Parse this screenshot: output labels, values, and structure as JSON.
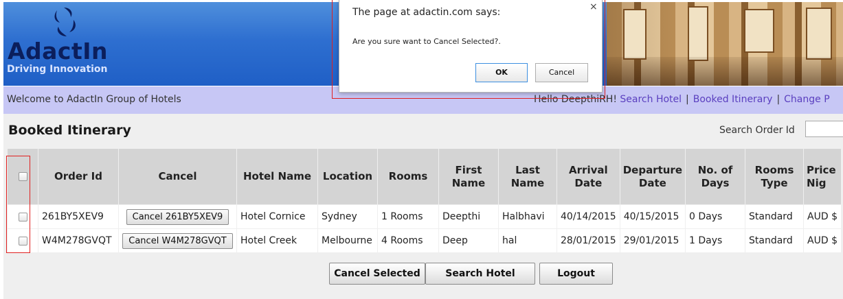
{
  "header": {
    "brand_name": "AdactIn",
    "tagline": "Driving Innovation"
  },
  "navbar": {
    "welcome": "Welcome to AdactIn Group of Hotels",
    "greeting": "Hello DeepthiRH!",
    "links": [
      "Search Hotel",
      "Booked Itinerary",
      "Change P"
    ]
  },
  "main": {
    "title": "Booked Itinerary",
    "search_label": "Search Order Id",
    "search_value": ""
  },
  "table": {
    "headers": [
      "Order Id",
      "Cancel",
      "Hotel Name",
      "Location",
      "Rooms",
      "First\nName",
      "Last\nName",
      "Arrival\nDate",
      "Departure\nDate",
      "No. of\nDays",
      "Rooms\nType",
      "Price\nNig"
    ],
    "rows": [
      {
        "order_id": "261BY5XEV9",
        "cancel_label": "Cancel 261BY5XEV9",
        "hotel_name": "Hotel Cornice",
        "location": "Sydney",
        "rooms": "1 Rooms",
        "first_name": "Deepthi",
        "last_name": "Halbhavi",
        "arrival": "40/14/2015",
        "departure": "40/15/2015",
        "days": "0 Days",
        "room_type": "Standard",
        "price": "AUD $"
      },
      {
        "order_id": "W4M278GVQT",
        "cancel_label": "Cancel W4M278GVQT",
        "hotel_name": "Hotel Creek",
        "location": "Melbourne",
        "rooms": "4 Rooms",
        "first_name": "Deep",
        "last_name": "hal",
        "arrival": "28/01/2015",
        "departure": "29/01/2015",
        "days": "1 Days",
        "room_type": "Standard",
        "price": "AUD $"
      }
    ]
  },
  "buttons": {
    "cancel_selected": "Cancel Selected",
    "search_hotel": "Search Hotel",
    "logout": "Logout"
  },
  "dialog": {
    "title": "The page at adactin.com says:",
    "close": "×",
    "message": "Are you sure want to Cancel Selected?.",
    "ok": "OK",
    "cancel": "Cancel"
  },
  "colors": {
    "header_blue": "#2e6fd0",
    "navbar": "#c7c7f5",
    "link": "#5a3fbf",
    "highlight_red": "#e02020"
  }
}
